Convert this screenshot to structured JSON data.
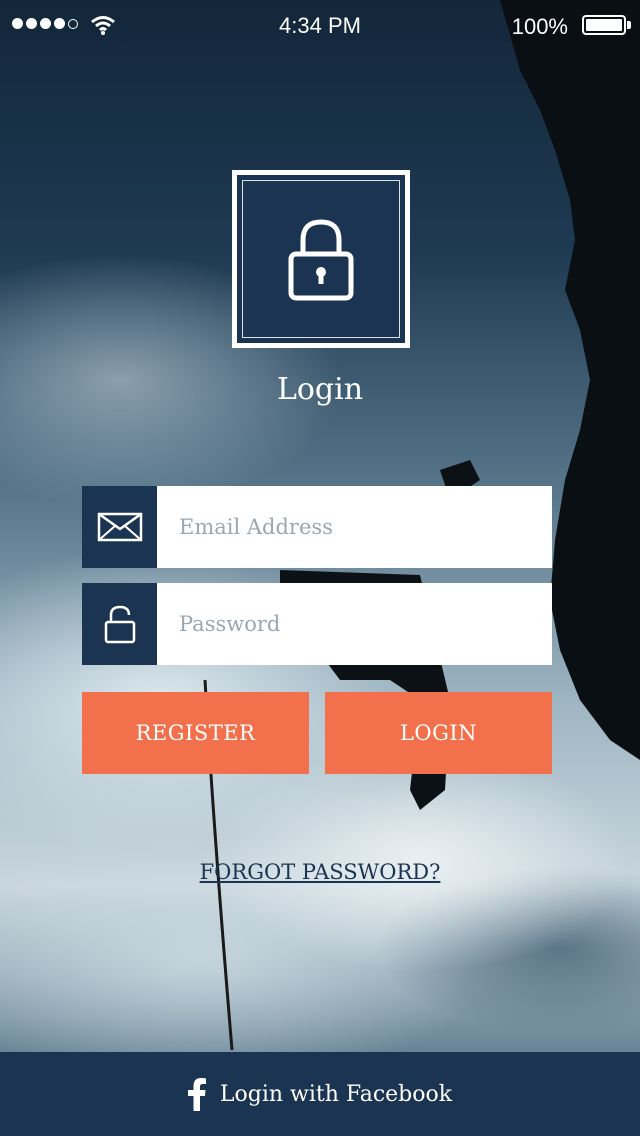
{
  "status_bar": {
    "time": "4:34 PM",
    "battery": "100%"
  },
  "header": {
    "title": "Login",
    "logo_icon": "padlock-icon"
  },
  "form": {
    "email": {
      "placeholder": "Email Address",
      "value": "",
      "icon": "envelope-icon"
    },
    "password": {
      "placeholder": "Password",
      "value": "",
      "icon": "padlock-icon"
    }
  },
  "buttons": {
    "register_label": "REGISTER",
    "login_label": "LOGIN"
  },
  "forgot_password_label": "FORGOT PASSWORD?",
  "facebook": {
    "label": "Login with Facebook",
    "icon": "facebook-icon"
  },
  "colors": {
    "navy": "#1b3451",
    "accent": "#f2714c"
  }
}
